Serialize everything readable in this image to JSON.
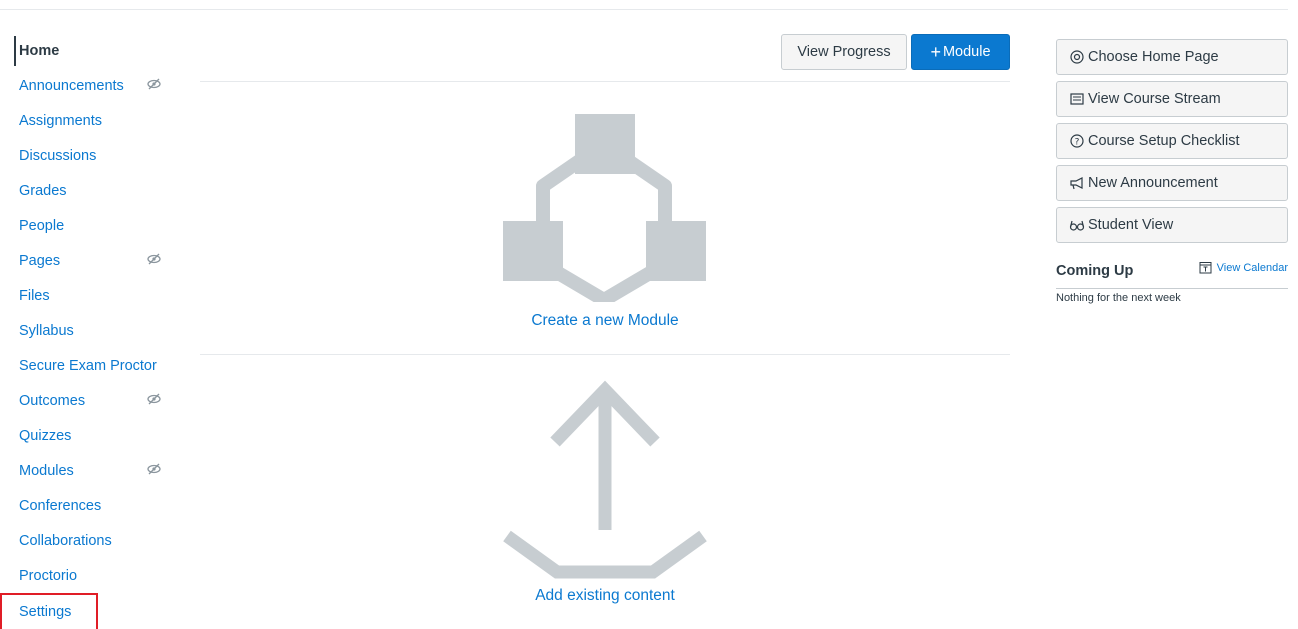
{
  "colors": {
    "link": "#0b79d0",
    "text": "#2d3b45",
    "primary_button": "#0b79d0",
    "illustration": "#c7cdd1",
    "highlight": "#e01d26"
  },
  "sidebar": {
    "items": [
      {
        "label": "Home",
        "active": true,
        "hidden_icon": false
      },
      {
        "label": "Announcements",
        "hidden_icon": true
      },
      {
        "label": "Assignments",
        "hidden_icon": false
      },
      {
        "label": "Discussions",
        "hidden_icon": false
      },
      {
        "label": "Grades",
        "hidden_icon": false
      },
      {
        "label": "People",
        "hidden_icon": false
      },
      {
        "label": "Pages",
        "hidden_icon": true
      },
      {
        "label": "Files",
        "hidden_icon": false
      },
      {
        "label": "Syllabus",
        "hidden_icon": false
      },
      {
        "label": "Secure Exam Proctor",
        "hidden_icon": false
      },
      {
        "label": "Outcomes",
        "hidden_icon": true
      },
      {
        "label": "Quizzes",
        "hidden_icon": false
      },
      {
        "label": "Modules",
        "hidden_icon": true
      },
      {
        "label": "Conferences",
        "hidden_icon": false
      },
      {
        "label": "Collaborations",
        "hidden_icon": false
      },
      {
        "label": "Proctorio",
        "hidden_icon": false
      },
      {
        "label": "Settings",
        "highlighted": true,
        "hidden_icon": false
      }
    ],
    "hidden_icon_name": "eye-slash-icon"
  },
  "toolbar": {
    "view_progress_label": "View Progress",
    "module_plus": "+",
    "module_label": "Module"
  },
  "empty_states": {
    "create_module_label": "Create a new Module",
    "create_module_icon": "modules-diagram-icon",
    "add_content_label": "Add existing content",
    "add_content_icon": "upload-arrow-icon"
  },
  "course_actions": {
    "buttons": [
      {
        "label": "Choose Home Page",
        "icon": "home-page-icon"
      },
      {
        "label": "View Course Stream",
        "icon": "stream-icon"
      },
      {
        "label": "Course Setup Checklist",
        "icon": "question-circle-icon"
      },
      {
        "label": "New Announcement",
        "icon": "megaphone-icon"
      },
      {
        "label": "Student View",
        "icon": "glasses-icon"
      }
    ]
  },
  "coming_up": {
    "title": "Coming Up",
    "view_calendar_label": "View Calendar",
    "empty_message": "Nothing for the next week"
  }
}
